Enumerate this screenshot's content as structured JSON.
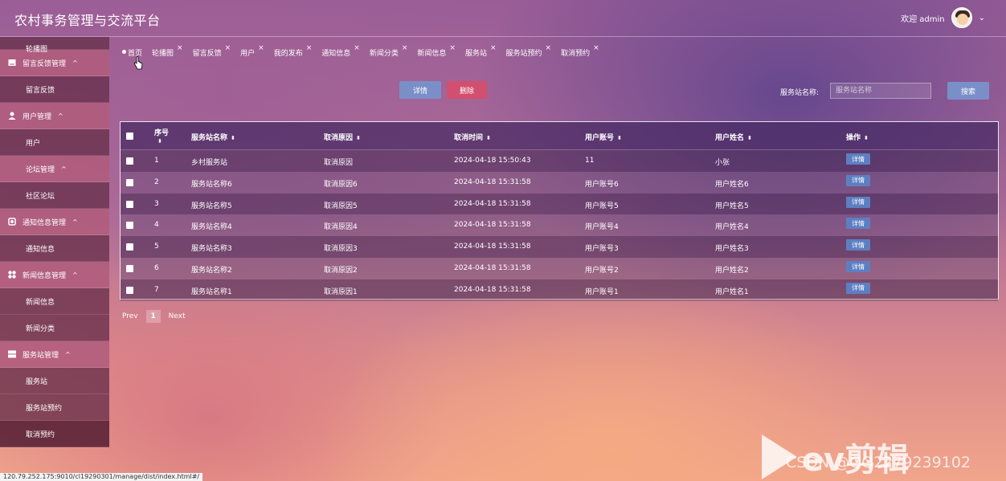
{
  "header": {
    "title": "农村事务管理与交流平台",
    "welcome": "欢迎 admin",
    "caret": "⌄"
  },
  "sidebar": {
    "cut_item": "轮播图",
    "groups": [
      {
        "label": "留言反馈管理",
        "icon": "message-square-icon",
        "caret": "^",
        "items": [
          "留言反馈"
        ]
      },
      {
        "label": "用户管理",
        "icon": "user-icon",
        "caret": "^",
        "items": [
          "用户"
        ]
      },
      {
        "label": "论坛管理",
        "icon": "",
        "caret": "^",
        "items": [
          "社区论坛"
        ]
      },
      {
        "label": "通知信息管理",
        "icon": "gear-icon",
        "caret": "^",
        "items": [
          "通知信息"
        ]
      },
      {
        "label": "新闻信息管理",
        "icon": "apps-icon",
        "caret": "^",
        "items": [
          "新闻信息",
          "新闻分类"
        ]
      },
      {
        "label": "服务站管理",
        "icon": "server-icon",
        "caret": "^",
        "items": [
          "服务站",
          "服务站预约",
          "取消预约"
        ]
      }
    ]
  },
  "tabs": [
    {
      "label": "首页",
      "closable": false
    },
    {
      "label": "轮播图",
      "closable": true
    },
    {
      "label": "留言反馈",
      "closable": true
    },
    {
      "label": "用户",
      "closable": true
    },
    {
      "label": "我的发布",
      "closable": true
    },
    {
      "label": "通知信息",
      "closable": true
    },
    {
      "label": "新闻分类",
      "closable": true
    },
    {
      "label": "新闻信息",
      "closable": true
    },
    {
      "label": "服务站",
      "closable": true
    },
    {
      "label": "服务站预约",
      "closable": true
    },
    {
      "label": "取消预约",
      "closable": true
    }
  ],
  "tab_close": "×",
  "toolbar": {
    "detail_label": "详情",
    "delete_label": "删除",
    "search_label": "服务站名称:",
    "search_placeholder": "服务站名称",
    "search_button": "搜索"
  },
  "table": {
    "columns": [
      "序号",
      "服务站名称",
      "取消原因",
      "取消时间",
      "用户账号",
      "用户姓名",
      "操作"
    ],
    "sort_glyph": "⬍",
    "action_label": "详情",
    "rows": [
      {
        "no": "1",
        "station": "乡村服务站",
        "reason": "取消原因",
        "time": "2024-04-18 15:50:43",
        "account": "11",
        "name": "小张"
      },
      {
        "no": "2",
        "station": "服务站名称6",
        "reason": "取消原因6",
        "time": "2024-04-18 15:31:58",
        "account": "用户账号6",
        "name": "用户姓名6"
      },
      {
        "no": "3",
        "station": "服务站名称5",
        "reason": "取消原因5",
        "time": "2024-04-18 15:31:58",
        "account": "用户账号5",
        "name": "用户姓名5"
      },
      {
        "no": "4",
        "station": "服务站名称4",
        "reason": "取消原因4",
        "time": "2024-04-18 15:31:58",
        "account": "用户账号4",
        "name": "用户姓名4"
      },
      {
        "no": "5",
        "station": "服务站名称3",
        "reason": "取消原因3",
        "time": "2024-04-18 15:31:58",
        "account": "用户账号3",
        "name": "用户姓名3"
      },
      {
        "no": "6",
        "station": "服务站名称2",
        "reason": "取消原因2",
        "time": "2024-04-18 15:31:58",
        "account": "用户账号2",
        "name": "用户姓名2"
      },
      {
        "no": "7",
        "station": "服务站名称1",
        "reason": "取消原因1",
        "time": "2024-04-18 15:31:58",
        "account": "用户账号1",
        "name": "用户姓名1"
      }
    ]
  },
  "pagination": {
    "prev": "Prev",
    "current": "1",
    "next": "Next"
  },
  "status_url": "120.79.252.175:9010/cl19290301/manage/dist/index.html#/",
  "watermark": {
    "brand": "ev剪辑",
    "csdn": "CSDN @QQ2279239102"
  },
  "colors": {
    "detail_button": "#7a8fc8",
    "delete_button": "#d24f6f",
    "action_button": "#5d7fc1"
  }
}
